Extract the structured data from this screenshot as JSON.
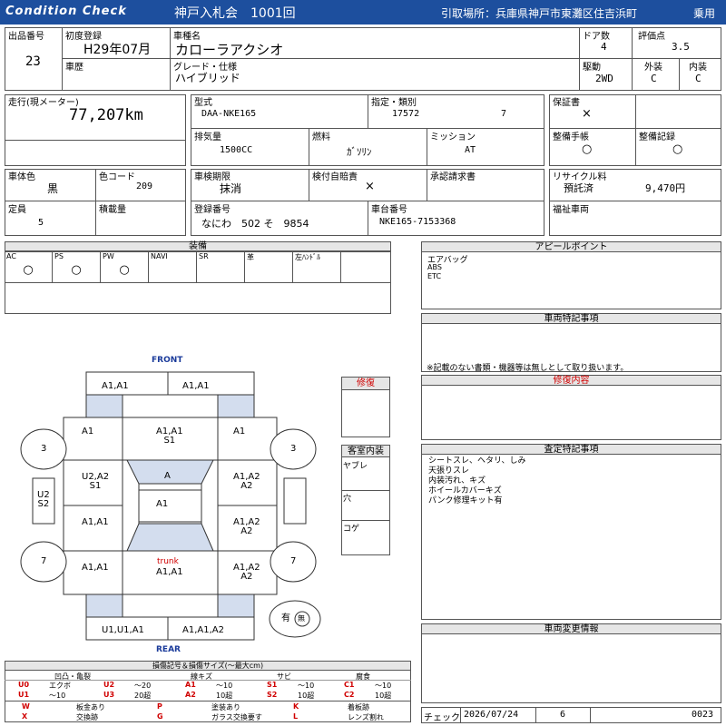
{
  "header": {
    "brand": "Condition  Check",
    "auction": "神戸入札会　1001回",
    "pickup": "引取場所：兵庫県神戸市東灘区住吉浜町",
    "category": "乗用"
  },
  "vehicle": {
    "lot_no_label": "出品番号",
    "lot_no": "23",
    "first_reg_label": "初度登録",
    "first_reg": "H29年07月",
    "name_label": "車種名",
    "name": "カローラアクシオ",
    "doors_label": "ドア数",
    "doors": "4",
    "score_label": "評価点",
    "score": "3.5",
    "history_label": "車歴",
    "grade_label": "グレード・仕様",
    "grade": "ハイブリッド",
    "drive_label": "駆動",
    "drive": "2WD",
    "ext_label": "外装",
    "ext": "C",
    "int_label": "内装",
    "int": "C",
    "mileage_label": "走行(現メーター)",
    "mileage": "77,207km",
    "model_label": "型式",
    "model": "DAA-NKE165",
    "designation_label": "指定・類別",
    "designation": "17572",
    "classification": "7",
    "warranty_label": "保証書",
    "warranty": "×",
    "displacement_label": "排気量",
    "displacement": "1500CC",
    "fuel_label": "燃料",
    "fuel": "ｶﾞｿﾘﾝ",
    "mission_label": "ミッション",
    "mission": "AT",
    "maint_book_label": "整備手帳",
    "maint_book": "○",
    "maint_record_label": "整備記録",
    "maint_record": "○",
    "body_color_label": "車体色",
    "body_color": "黒",
    "color_code_label": "色コード",
    "color_code": "209",
    "inspection_label": "車検期限",
    "inspection": "抹消",
    "insurance_label": "検付自賠責",
    "insurance": "×",
    "approval_label": "承認請求書",
    "recycle_label": "リサイクル料",
    "recycle_status": "預託済",
    "recycle_amount": "9,470円",
    "capacity_label": "定員",
    "capacity": "5",
    "load_label": "積載量",
    "reg_no_label": "登録番号",
    "reg_no": "なにわ　502 そ　9854",
    "chassis_label": "車台番号",
    "chassis": "NKE165-7153368",
    "welfare_label": "福祉車両"
  },
  "equipment": {
    "title": "装備",
    "items": [
      {
        "label": "AC",
        "value": "○"
      },
      {
        "label": "PS",
        "value": "○"
      },
      {
        "label": "PW",
        "value": "○"
      },
      {
        "label": "NAVI",
        "value": ""
      },
      {
        "label": "SR",
        "value": ""
      },
      {
        "label": "革",
        "value": ""
      },
      {
        "label": "左ﾊﾝﾄﾞﾙ",
        "value": ""
      }
    ]
  },
  "appeal": {
    "title": "アピールポイント",
    "lines": [
      "エアバッグ",
      "ABS",
      "ETC"
    ]
  },
  "special": {
    "title": "車両特記事項",
    "note": "※記載のない書類・機器等は無しとして取り扱います。"
  },
  "repair": {
    "title": "修復内容"
  },
  "inspection_notes": {
    "title": "査定特記事項",
    "lines": [
      "シートスレ、ヘタリ、しみ",
      "天張りスレ",
      "内装汚れ、キズ",
      "ホイールカバーキズ",
      "パンク修理キット有"
    ]
  },
  "changes": {
    "title": "車両変更情報"
  },
  "diagram": {
    "front": "FRONT",
    "rear": "REAR",
    "trunk": "trunk",
    "marks": {
      "front_bumper_l": "A1,A1",
      "front_bumper_r": "A1,A1",
      "fender_fl": "A1",
      "hood": "A1,A1\nS1",
      "fender_fr": "A1",
      "door_fl": "U2,A2\nS1",
      "windshield": "A",
      "door_fr": "A1,A2\nA2",
      "roof": "A1",
      "door_rl": "A1,A1",
      "door_rr": "A1,A2\nA2",
      "qtr_rl": "A1,A1",
      "trunk_lid": "A1,A1",
      "qtr_rr": "A1,A2\nA2",
      "rear_bumper_l": "U1,U1,A1",
      "rear_bumper_r": "A1,A1,A2",
      "tire_fl": "3",
      "tire_fr": "3",
      "tire_rl": "7",
      "tire_rr": "7",
      "rocker_l": "U2\nS2",
      "spare": "有",
      "spare_mark": "無"
    }
  },
  "repair_box": {
    "title": "修復"
  },
  "interior": {
    "title": "客室内装",
    "items": [
      "ヤブレ",
      "穴",
      "コゲ"
    ]
  },
  "legend": {
    "title": "損傷記号＆損傷サイズ(～最大cm)",
    "groups": [
      "凹凸・亀裂",
      "線キズ",
      "サビ",
      "腐食"
    ],
    "row1": [
      {
        "code": "U0",
        "desc": "エクボ"
      },
      {
        "code": "U2",
        "desc": "～20"
      },
      {
        "code": "A1",
        "desc": "～10"
      },
      {
        "code": "S1",
        "desc": "～10"
      },
      {
        "code": "C1",
        "desc": "～10"
      }
    ],
    "row2": [
      {
        "code": "U1",
        "desc": "～10"
      },
      {
        "code": "U3",
        "desc": "20超"
      },
      {
        "code": "A2",
        "desc": "10超"
      },
      {
        "code": "S2",
        "desc": "10超"
      },
      {
        "code": "C2",
        "desc": "10超"
      }
    ],
    "marks": [
      {
        "code": "W",
        "desc": "板金あり"
      },
      {
        "code": "P",
        "desc": "塗装あり"
      },
      {
        "code": "K",
        "desc": "着板跡"
      },
      {
        "code": "X",
        "desc": "交換跡"
      },
      {
        "code": "G",
        "desc": "ガラス交換要す"
      },
      {
        "code": "L",
        "desc": "レンズ割れ"
      }
    ]
  },
  "check": {
    "label": "チェック",
    "date": "2026/07/24",
    "num": "6",
    "id": "0023"
  }
}
